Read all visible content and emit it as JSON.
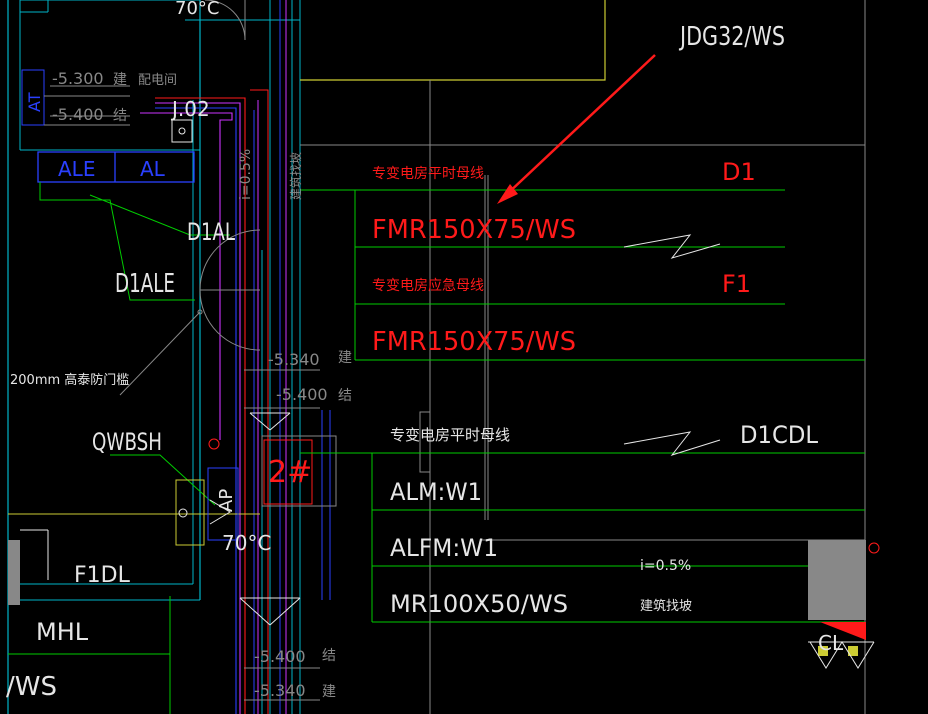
{
  "colors": {
    "background": "#000000",
    "green": "#00cc00",
    "cyan": "#00b4c8",
    "blue": "#2a40ff",
    "red": "#ff1a1a",
    "magenta": "#cc33ff",
    "yellow": "#cccc33",
    "white": "#e6e6e6",
    "gray": "#888888"
  },
  "annotation": {
    "callout": "JDG32/WS"
  },
  "busbars": {
    "label_normal_1": "专变电房平时母线",
    "label_emergency": "专变电房应急母线",
    "label_normal_2": "专变电房平时母线",
    "spec_1": "FMR150X75/WS",
    "spec_2": "FMR150X75/WS",
    "tag_d1": "D1",
    "tag_f1": "F1",
    "tag_d1cdl": "D1CDL",
    "row_alm": "ALM:W1",
    "row_alfm": "ALFM:W1",
    "row_mr": "MR100X50/WS"
  },
  "left_plan": {
    "temp_top": "70°C",
    "elev_5300": "-5.300",
    "elev_5400": "-5.400",
    "jian": "建",
    "jie": "结",
    "pei_dian_jian": "配电间",
    "at_label": "AT",
    "box_ale": "ALE",
    "box_al": "AL",
    "j02": "J.02",
    "d1al": "D1AL",
    "d1ale": "D1ALE",
    "slope_vertical": "i=0.5%",
    "jianzhu_zhaopo_v": "建筑找坡",
    "wall_note": "200mm  高泰防门槛",
    "qwbsh": "QWBSH",
    "ap_label": "AP",
    "temp_mid": "70°C",
    "elev_5340_a": "-5.340",
    "elev_5400_a": "-5.400",
    "jian_a": "建",
    "jie_a": "结",
    "room_2": "2#",
    "f1dl": "F1DL",
    "mhl": "MHL",
    "ws_bottom": "/WS",
    "elev_5400_b": "-5.400",
    "elev_5340_b": "-5.340",
    "jie_b": "结",
    "jian_b": "建"
  },
  "right_plan": {
    "slope": "i=0.5%",
    "jianzhu_zhaopo": "建筑找坡",
    "cl": "CL"
  }
}
